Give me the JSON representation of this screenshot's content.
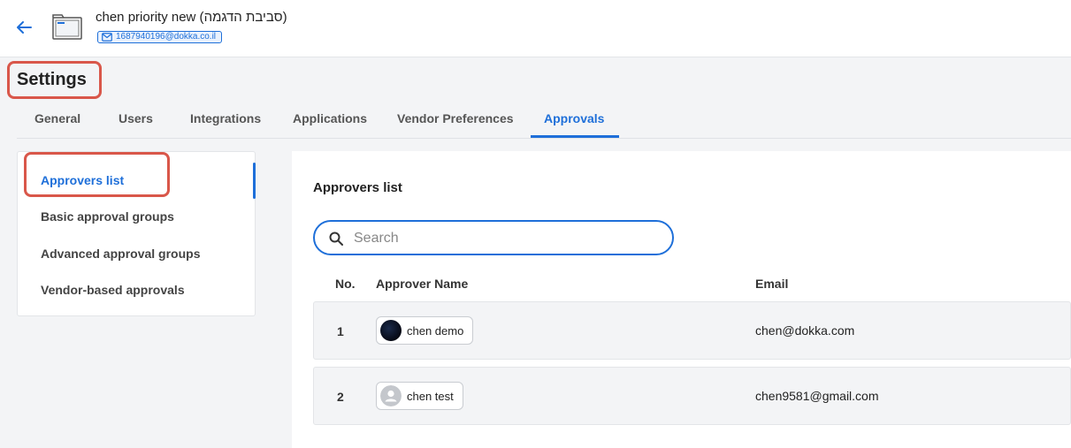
{
  "header": {
    "company_name": "chen priority new (סביבת הדגמה)",
    "company_email": "1687940196@dokka.co.il"
  },
  "page_title": "Settings",
  "tabs": [
    {
      "label": "General",
      "active": false
    },
    {
      "label": "Users",
      "active": false
    },
    {
      "label": "Integrations",
      "active": false
    },
    {
      "label": "Applications",
      "active": false
    },
    {
      "label": "Vendor Preferences",
      "active": false
    },
    {
      "label": "Approvals",
      "active": true
    }
  ],
  "sidebar": {
    "items": [
      {
        "label": "Approvers list",
        "active": true
      },
      {
        "label": "Basic approval groups",
        "active": false
      },
      {
        "label": "Advanced approval groups",
        "active": false
      },
      {
        "label": "Vendor-based approvals",
        "active": false
      }
    ]
  },
  "main": {
    "title": "Approvers list",
    "search": {
      "placeholder": "Search",
      "value": ""
    },
    "columns": {
      "no": "No.",
      "name": "Approver Name",
      "email": "Email"
    },
    "rows": [
      {
        "no": "1",
        "name": "chen demo",
        "email": "chen@dokka.com",
        "avatar": "dark-logo-avatar"
      },
      {
        "no": "2",
        "name": "chen test",
        "email": "chen9581@gmail.com",
        "avatar": "default-user-avatar"
      }
    ]
  },
  "colors": {
    "accent": "#1e6fd9",
    "highlight": "#d9574a",
    "background": "#f3f4f6"
  },
  "icons": [
    "back-arrow-icon",
    "company-folder-icon",
    "mail-icon",
    "search-icon",
    "user-icon"
  ]
}
